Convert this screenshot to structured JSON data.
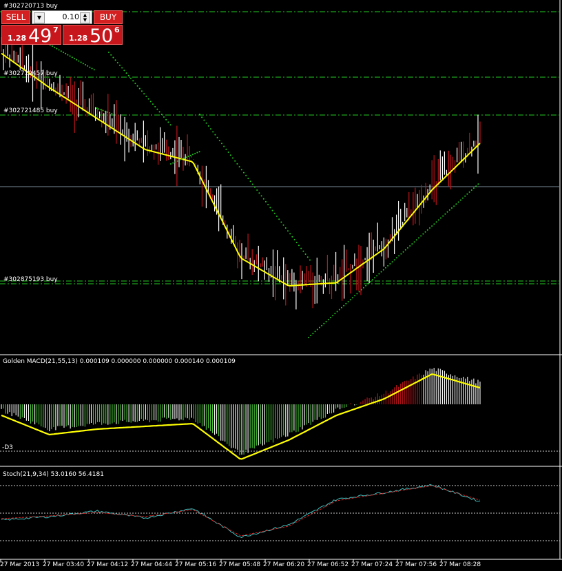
{
  "trade_panel": {
    "sell_label": "SELL",
    "buy_label": "BUY",
    "lot_value": "0.10",
    "sell_big": "1.28",
    "sell_pips": "49",
    "sell_point": "7",
    "buy_big": "1.28",
    "buy_pips": "50",
    "buy_point": "6"
  },
  "order_labels": [
    "#302720713 buy",
    "#302719457 buy",
    "#302721485 buy",
    "#302875193 buy"
  ],
  "macd_label": "Golden MACD(21,55,13) 0.000109 0.000000 0.000000 0.000140 0.000109",
  "macd_level_label": "-D3",
  "stoch_label": "Stoch(21,9,34) 53.0160 56.4181",
  "time_labels": [
    "27 Mar 2013",
    "27 Mar 03:40",
    "27 Mar 04:12",
    "27 Mar 04:44",
    "27 Mar 05:16",
    "27 Mar 05:48",
    "27 Mar 06:20",
    "27 Mar 06:52",
    "27 Mar 07:24",
    "27 Mar 07:56",
    "27 Mar 08:28"
  ],
  "colors": {
    "background": "#000000",
    "bull_candle": "#ffffff",
    "bear_candle": "#c0141a",
    "ma_line": "#ffff00",
    "psar_dots": "#22cc22",
    "order_lines": "#22cc22",
    "hist_green": "#4cc93a",
    "hist_red": "#c0141a",
    "hist_white": "#ffffff",
    "stoch_main": "#40c0c0",
    "stoch_signal": "#e02020",
    "grid_dots": "#cccccc"
  },
  "chart_data": [
    {
      "type": "line",
      "title": "",
      "x": [
        "27 Mar 2013",
        "27 Mar 03:40",
        "27 Mar 04:12",
        "27 Mar 04:44",
        "27 Mar 05:16",
        "27 Mar 05:48",
        "27 Mar 06:20",
        "27 Mar 06:52",
        "27 Mar 07:24",
        "27 Mar 07:56",
        "27 Mar 08:28"
      ],
      "series": [
        {
          "values": [
            0.93,
            0.82,
            0.72,
            0.62,
            0.58,
            0.27,
            0.18,
            0.19,
            0.3,
            0.49,
            0.64
          ]
        }
      ],
      "ylim": [
        0,
        1
      ]
    },
    {
      "type": "bar",
      "title": "Golden MACD(21,55,13) 0.000109 0.000000 0.000000 0.000140 0.000109",
      "x": [
        "27 Mar 2013",
        "27 Mar 03:40",
        "27 Mar 04:12",
        "27 Mar 04:44",
        "27 Mar 05:16",
        "27 Mar 05:48",
        "27 Mar 06:20",
        "27 Mar 06:52",
        "27 Mar 07:24",
        "27 Mar 07:56",
        "27 Mar 08:28"
      ],
      "series": [
        {
          "values": [
            -0.1,
            -0.45,
            -0.35,
            -0.3,
            -0.25,
            -0.9,
            -0.55,
            -0.1,
            0.2,
            0.65,
            0.4
          ]
        }
      ],
      "ylim": [
        -1,
        1
      ]
    },
    {
      "type": "line",
      "title": "Stoch(21,9,34) 53.0160 56.4181",
      "x": [
        "27 Mar 2013",
        "27 Mar 03:40",
        "27 Mar 04:12",
        "27 Mar 04:44",
        "27 Mar 05:16",
        "27 Mar 05:48",
        "27 Mar 06:20",
        "27 Mar 06:52",
        "27 Mar 07:24",
        "27 Mar 07:56",
        "27 Mar 08:28"
      ],
      "series": [
        {
          "values": [
            45,
            50,
            58,
            48,
            62,
            20,
            38,
            75,
            85,
            96,
            72
          ]
        },
        {
          "values": [
            47,
            51,
            56,
            50,
            60,
            22,
            36,
            73,
            84,
            95,
            74
          ]
        }
      ],
      "ylim": [
        0,
        100
      ]
    }
  ]
}
